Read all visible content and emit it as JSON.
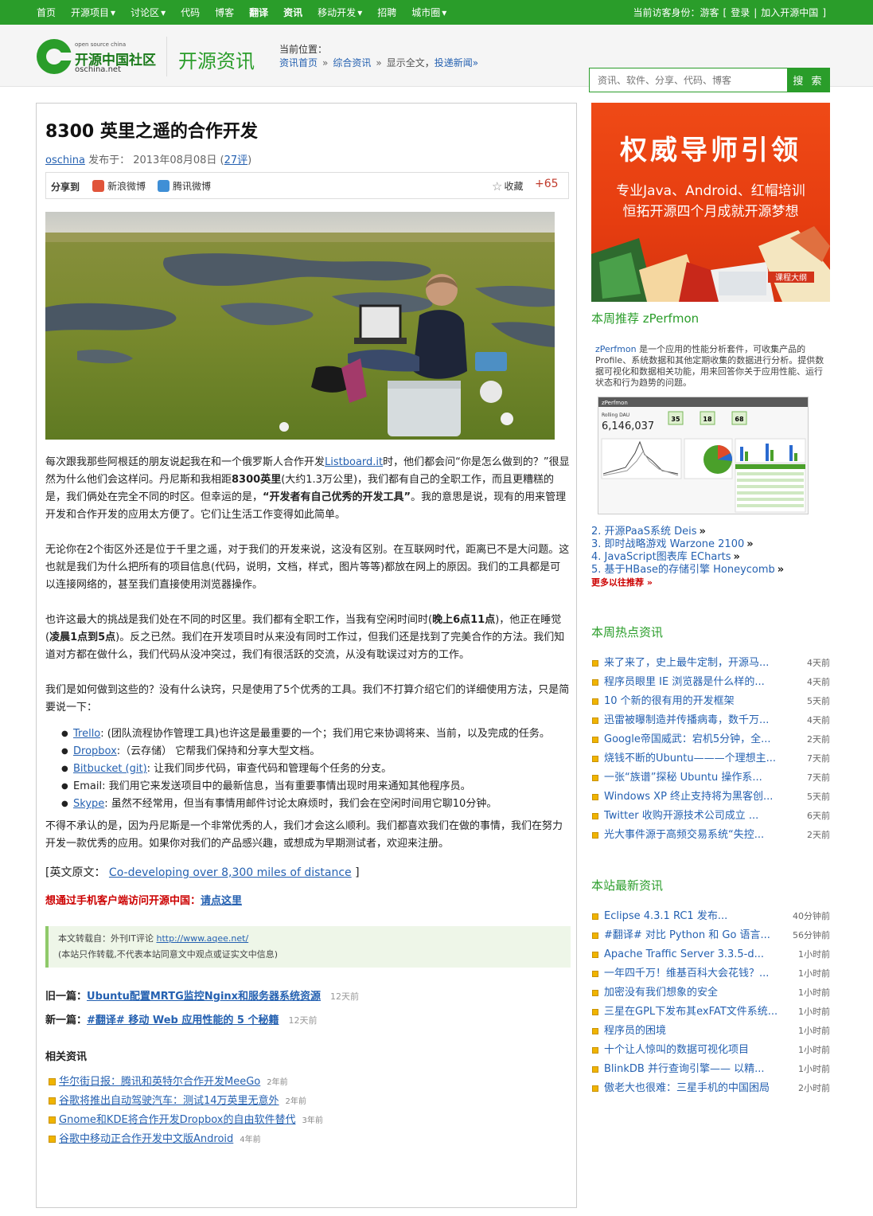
{
  "topnav": {
    "items": [
      {
        "label": "首页",
        "caret": false,
        "bold": false
      },
      {
        "label": "开源项目",
        "caret": true,
        "bold": false
      },
      {
        "label": "讨论区",
        "caret": true,
        "bold": false
      },
      {
        "label": "代码",
        "caret": false,
        "bold": false
      },
      {
        "label": "博客",
        "caret": false,
        "bold": false
      },
      {
        "label": "翻译",
        "caret": false,
        "bold": true
      },
      {
        "label": "资讯",
        "caret": false,
        "bold": true
      },
      {
        "label": "移动开发",
        "caret": true,
        "bold": false
      },
      {
        "label": "招聘",
        "caret": false,
        "bold": false
      },
      {
        "label": "城市圈",
        "caret": true,
        "bold": false
      }
    ],
    "identity": "当前访客身份：游客",
    "bracket_open": "[",
    "login": "登录",
    "divider": "|",
    "join": "加入开源中国",
    "bracket_close": "]"
  },
  "header": {
    "logo_small": "open source china",
    "logo_cn": "开源中国社区",
    "logo_net": "oschina.net",
    "section_title": "开源资讯",
    "location_label": "当前位置：",
    "crumbs": {
      "home": "资讯首页",
      "arr": "»",
      "category": "综合资讯",
      "current": "显示全文",
      "comma": "，",
      "submit": "投递新闻»"
    },
    "search_placeholder": "资讯、软件、分享、代码、博客",
    "search_button": "搜 索"
  },
  "article": {
    "title": "8300 英里之遥的合作开发",
    "author": "oschina",
    "published_label": "发布于：",
    "date": "2013年08月08日",
    "comments_open": "(",
    "comments": "27评",
    "comments_close": ")",
    "share_label": "分享到",
    "share_weibo": "新浪微博",
    "share_qq": "腾讯微博",
    "fav_label": "收藏",
    "fav_count": "+65",
    "p1": {
      "a": "每次跟我那些阿根廷的朋友说起我在和一个俄罗斯人合作开发",
      "link": "Listboard.it",
      "b": "时，他们都会问“你是怎么做到的？”很显然为什么他们会这样问。丹尼斯和我相距",
      "bold1": "8300英里",
      "c": "(大约1.3万公里)，我们都有自己的全职工作，而且更糟糕的是，我们俩处在完全不同的时区。但幸运的是，",
      "bold2": "“开发者有自己优秀的开发工具”",
      "d": "。我的意思是说，现有的用来管理开发和合作开发的应用太方便了。它们让生活工作变得如此简单。"
    },
    "p2": "无论你在2个街区外还是位于千里之遥，对于我们的开发来说，这没有区别。在互联网时代，距离已不是大问题。这也就是我们为什么把所有的项目信息(代码，说明，文档，样式，图片等等)都放在网上的原因。我们的工具都是可以连接网络的，甚至我们直接使用浏览器操作。",
    "p3": {
      "a": "也许这最大的挑战是我们处在不同的时区里。我们都有全职工作，当我有空闲时间时(",
      "bold1": "晚上6点11点",
      "b": ")，他正在睡觉(",
      "bold2": "凌晨1点到5点",
      "c": ")。反之已然。我们在开发项目时从来没有同时工作过，但我们还是找到了完美合作的方法。我们知道对方都在做什么，我们代码从没冲突过，我们有很活跃的交流，从没有耽误过对方的工作。"
    },
    "p4": "我们是如何做到这些的？没有什么诀窍，只是使用了5个优秀的工具。我们不打算介绍它们的详细使用方法，只是简要说一下：",
    "tools": [
      {
        "link": "Trello",
        "text": ": (团队流程协作管理工具)也许这是最重要的一个；我们用它来协调将来、当前，以及完成的任务。"
      },
      {
        "link": "Dropbox",
        "text": ":（云存储） 它帮我们保持和分享大型文档。"
      },
      {
        "link": "Bitbucket (git)",
        "text": ": 让我们同步代码，审查代码和管理每个任务的分支。"
      },
      {
        "link": "",
        "text": "Email: 我们用它来发送项目中的最新信息，当有重要事情出现时用来通知其他程序员。"
      },
      {
        "link": "Skype",
        "text": ": 虽然不经常用，但当有事情用邮件讨论太麻烦时，我们会在空闲时间用它聊10分钟。"
      }
    ],
    "p5": "不得不承认的是，因为丹尼斯是一个非常优秀的人，我们才会这么顺利。我们都喜欢我们在做的事情，我们在努力开发一款优秀的应用。如果你对我们的产品感兴趣，或想成为早期测试者，欢迎来注册。",
    "origin_label": "[英文原文：",
    "origin_link": "Co-developing over 8,300 miles of distance",
    "origin_end": "]",
    "mobile_tip": "想通过手机客户端访问开源中国：",
    "mobile_link": "请点这里",
    "repost_line1_a": "本文转载自：外刊IT评论",
    "repost_line1_link": "http://www.aqee.net/",
    "repost_line2": "(本站只作转载,不代表本站同意文中观点或证实文中信息)",
    "prev_label": "旧一篇：",
    "prev_title": "Ubuntu配置MRTG监控Nginx和服务器系统资源",
    "prev_time": "12天前",
    "next_label": "新一篇：",
    "next_title": "#翻译# 移动 Web 应用性能的 5 个秘籍",
    "next_time": "12天前",
    "related_heading": "相关资讯",
    "related": [
      {
        "title": "华尔街日报：腾讯和英特尔合作开发MeeGo",
        "time": "2年前"
      },
      {
        "title": "谷歌将推出自动驾驶汽车：测试14万英里无意外",
        "time": "2年前"
      },
      {
        "title": "Gnome和KDE将合作开发Dropbox的自由软件替代",
        "time": "3年前"
      },
      {
        "title": "谷歌中移动正合作开发中文版Android",
        "time": "4年前"
      }
    ]
  },
  "sidebar": {
    "ad_line1": "权威导师引领",
    "ad_line2": "专业Java、Android、红帽培训",
    "ad_line3": "恒拓开源四个月成就开源梦想",
    "ad_book_label": "课程大纲",
    "weekly_heading": "本周推荐 zPerfmon",
    "zp_link": "zPerfmon",
    "zp_desc": " 是一个应用的性能分析套件，可收集产品的Profile、系统数据和其他定期收集的数据进行分析。提供数据可视化和数据相关功能，用来回答你关于应用性能、运行状态和行为趋势的问题。",
    "zp_img_title": "zPerfmon",
    "zp_img_metric_label": "Rolling DAU",
    "zp_img_metric": "6,146,037",
    "zp_img_badges": [
      "35",
      "18",
      "68"
    ],
    "recommend": [
      "2. 开源PaaS系统 Deis",
      "3. 即时战略游戏 Warzone 2100",
      "4. JavaScript图表库 ECharts",
      "5. 基于HBase的存储引擎 Honeycomb"
    ],
    "recommend_arrow": "»",
    "more_recommend": "更多以往推荐 »",
    "hot_heading": "本周热点资讯",
    "hot": [
      {
        "title": "来了来了，史上最牛定制，开源马...",
        "time": "4天前"
      },
      {
        "title": "程序员眼里 IE 浏览器是什么样的...",
        "time": "4天前"
      },
      {
        "title": "10 个新的很有用的开发框架",
        "time": "5天前"
      },
      {
        "title": "迅雷被曝制造并传播病毒，数千万...",
        "time": "4天前"
      },
      {
        "title": "Google帝国威武：宕机5分钟，全...",
        "time": "2天前"
      },
      {
        "title": "烧钱不断的Ubuntu———个理想主...",
        "time": "7天前"
      },
      {
        "title": "一张“族谱”探秘 Ubuntu 操作系...",
        "time": "7天前"
      },
      {
        "title": "Windows XP 终止支持将为黑客创...",
        "time": "5天前"
      },
      {
        "title": "Twitter 收购开源技术公司成立 ...",
        "time": "6天前"
      },
      {
        "title": "光大事件源于高频交易系统“失控...",
        "time": "2天前"
      }
    ],
    "latest_heading": "本站最新资讯",
    "latest": [
      {
        "title": "Eclipse 4.3.1 RC1 发布...",
        "time": "40分钟前"
      },
      {
        "title": "#翻译# 对比 Python 和 Go 语言...",
        "time": "56分钟前"
      },
      {
        "title": "Apache Traffic Server 3.3.5-d...",
        "time": "1小时前"
      },
      {
        "title": "一年四千万！维基百科大会花钱？...",
        "time": "1小时前"
      },
      {
        "title": "加密没有我们想象的安全",
        "time": "1小时前"
      },
      {
        "title": "三星在GPL下发布其exFAT文件系统...",
        "time": "1小时前"
      },
      {
        "title": "程序员的困境",
        "time": "1小时前"
      },
      {
        "title": "十个让人惊叫的数据可视化项目",
        "time": "1小时前"
      },
      {
        "title": "BlinkDB 并行查询引擎—— 以精...",
        "time": "1小时前"
      },
      {
        "title": "傲老大也很难：三星手机的中国困局",
        "time": "2小时前"
      }
    ]
  }
}
